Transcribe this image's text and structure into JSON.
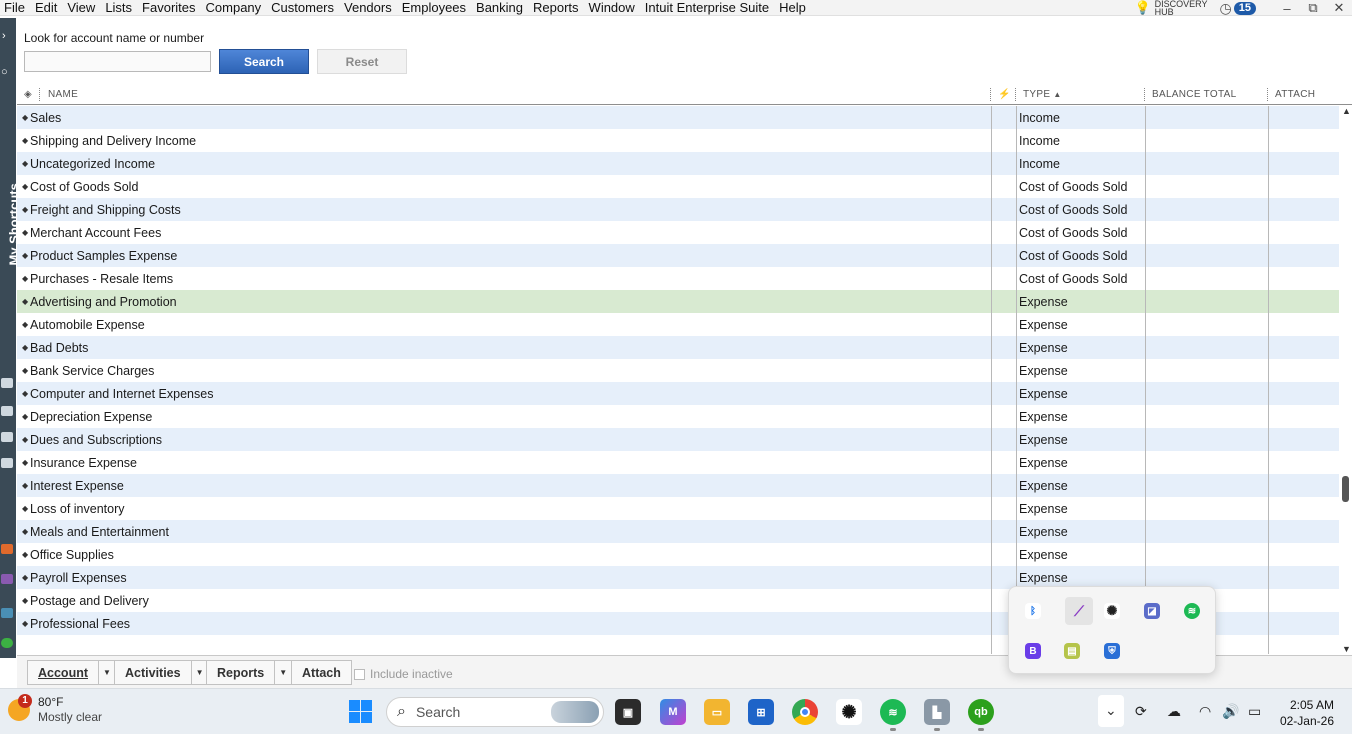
{
  "menu": [
    "File",
    "Edit",
    "View",
    "Lists",
    "Favorites",
    "Company",
    "Customers",
    "Vendors",
    "Employees",
    "Banking",
    "Reports",
    "Window",
    "Intuit Enterprise Suite",
    "Help"
  ],
  "discovery_hub": {
    "line1": "DISCOVERY",
    "line2": "HUB"
  },
  "notification_count": "15",
  "shortcuts_label": "My Shortcuts",
  "search": {
    "label": "Look for account name or number",
    "value": "",
    "search_button": "Search",
    "reset_button": "Reset"
  },
  "columns": {
    "name": "NAME",
    "type": "TYPE",
    "balance": "BALANCE TOTAL",
    "attach": "ATTACH"
  },
  "accounts": [
    {
      "name": "Sales",
      "type": "Income"
    },
    {
      "name": "Shipping and Delivery Income",
      "type": "Income"
    },
    {
      "name": "Uncategorized Income",
      "type": "Income"
    },
    {
      "name": "Cost of Goods Sold",
      "type": "Cost of Goods Sold"
    },
    {
      "name": "Freight and Shipping Costs",
      "type": "Cost of Goods Sold"
    },
    {
      "name": "Merchant Account Fees",
      "type": "Cost of Goods Sold"
    },
    {
      "name": "Product Samples Expense",
      "type": "Cost of Goods Sold"
    },
    {
      "name": "Purchases - Resale Items",
      "type": "Cost of Goods Sold"
    },
    {
      "name": "Advertising and Promotion",
      "type": "Expense"
    },
    {
      "name": "Automobile Expense",
      "type": "Expense"
    },
    {
      "name": "Bad Debts",
      "type": "Expense"
    },
    {
      "name": "Bank Service Charges",
      "type": "Expense"
    },
    {
      "name": "Computer and Internet Expenses",
      "type": "Expense"
    },
    {
      "name": "Depreciation Expense",
      "type": "Expense"
    },
    {
      "name": "Dues and Subscriptions",
      "type": "Expense"
    },
    {
      "name": "Insurance Expense",
      "type": "Expense"
    },
    {
      "name": "Interest Expense",
      "type": "Expense"
    },
    {
      "name": "Loss of inventory",
      "type": "Expense"
    },
    {
      "name": "Meals and Entertainment",
      "type": "Expense"
    },
    {
      "name": "Office Supplies",
      "type": "Expense"
    },
    {
      "name": "Payroll Expenses",
      "type": "Expense"
    },
    {
      "name": "Postage and Delivery",
      "type": ""
    },
    {
      "name": "Professional Fees",
      "type": ""
    }
  ],
  "bottom": {
    "account": "Account",
    "activities": "Activities",
    "reports": "Reports",
    "attach": "Attach",
    "include_inactive": "Include inactive"
  },
  "weather": {
    "badge": "1",
    "temp": "80°F",
    "condition": "Mostly clear"
  },
  "taskbar": {
    "search_placeholder": "Search"
  },
  "clock": {
    "time": "2:05 AM",
    "date": "02-Jan-26"
  },
  "colors": {
    "selected_row": "#d8ead1",
    "alt_row": "#e6effa",
    "search_button": "#2d63b5",
    "shortcuts_bg": "#3a4a56"
  }
}
